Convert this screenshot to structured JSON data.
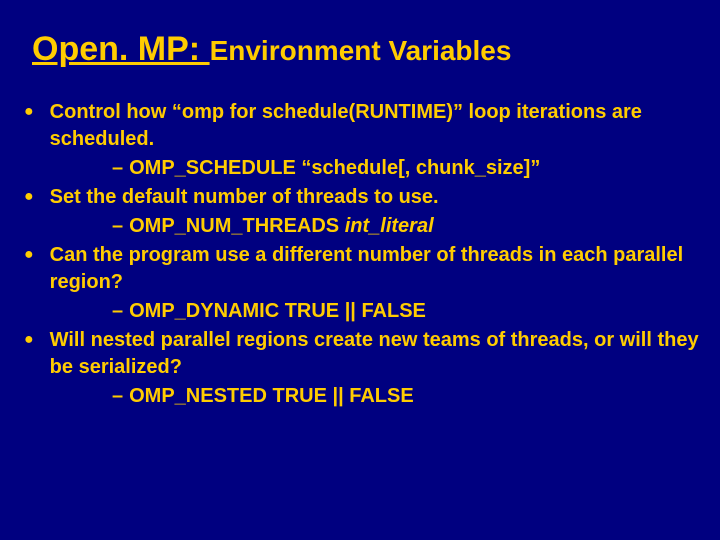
{
  "title": {
    "main": "Open. MP: ",
    "sub": "Environment Variables"
  },
  "bullets": [
    {
      "text": "Control how “omp for schedule(RUNTIME)” loop iterations are scheduled.",
      "sub": "OMP_SCHEDULE “schedule[, chunk_size]”"
    },
    {
      "text": "Set the default number of threads to use.",
      "sub_html": "OMP_NUM_THREADS <span class=\"italic\">int_literal</span>"
    },
    {
      "text": "Can the program use a different number of threads in each parallel region?",
      "sub": "OMP_DYNAMIC TRUE || FALSE"
    },
    {
      "text": "Will nested parallel regions create new teams of threads, or will they be serialized?",
      "sub": "OMP_NESTED TRUE || FALSE"
    }
  ]
}
